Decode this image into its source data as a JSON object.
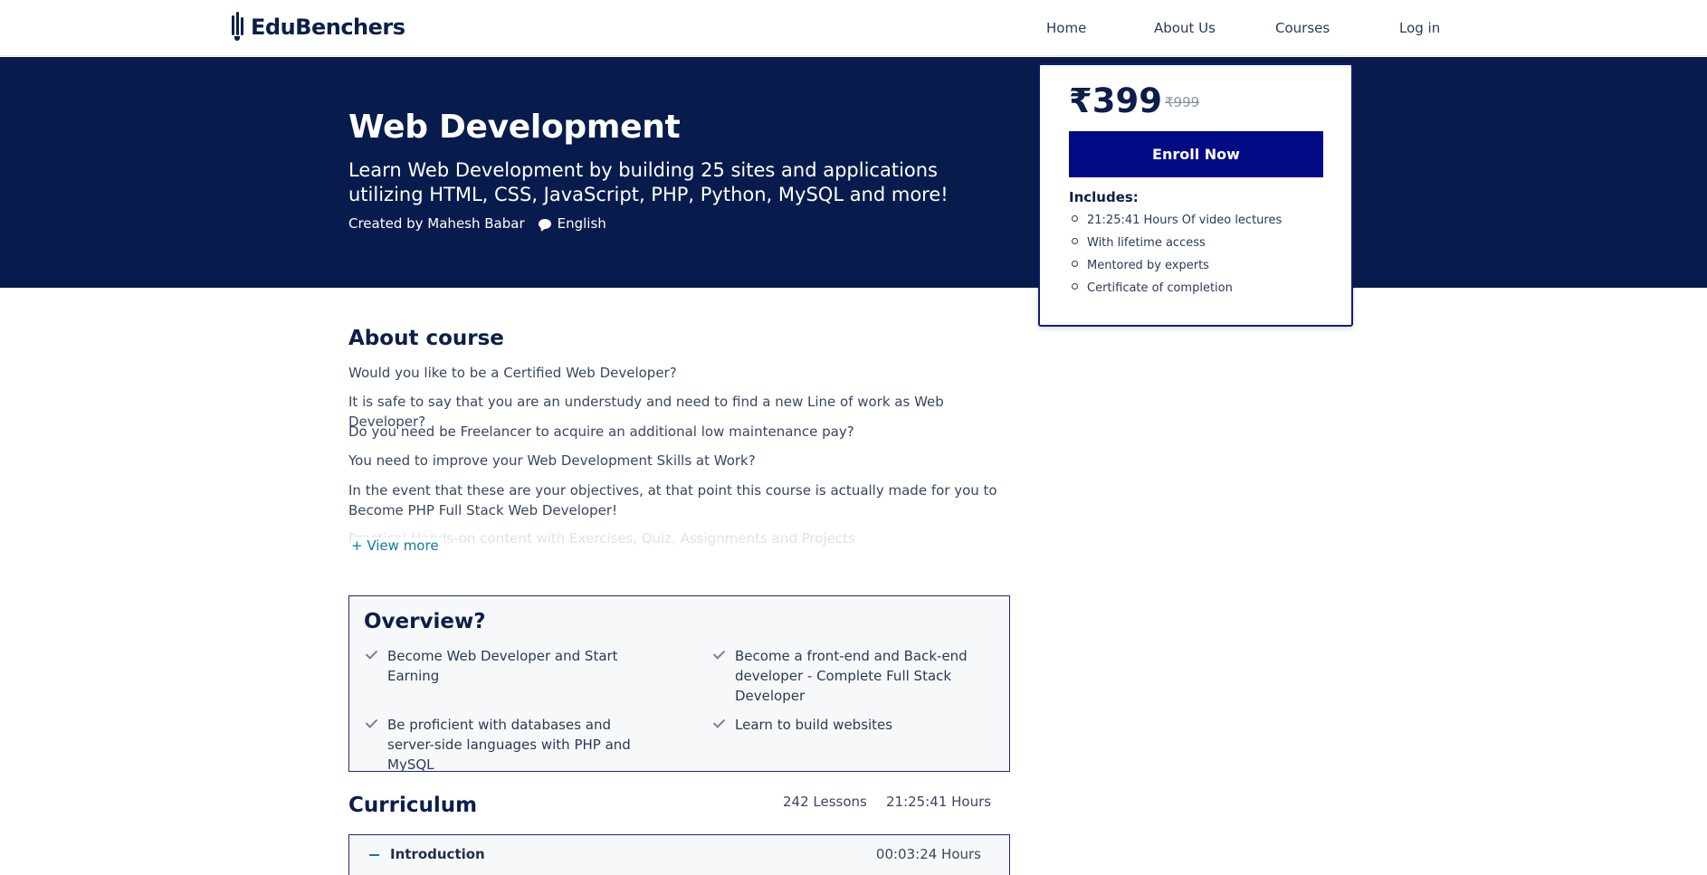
{
  "nav": {
    "brand": "EduBenchers",
    "links": [
      "Home",
      "About Us",
      "Courses",
      "Log in"
    ]
  },
  "hero": {
    "title": "Web Development",
    "subtitle": "Learn Web Development by building 25 sites and applications utilizing HTML, CSS, JavaScript, PHP, Python, MySQL and more!",
    "created_by": "Created by Mahesh Babar",
    "language": "English"
  },
  "pricing": {
    "price": "₹399",
    "original_price": "₹999",
    "enroll_label": "Enroll Now",
    "includes_label": "Includes:",
    "includes": [
      "21:25:41 Hours Of video lectures",
      "With lifetime access",
      "Mentored by experts",
      "Certificate of completion"
    ]
  },
  "about": {
    "heading": "About course",
    "paragraphs": [
      "Would you like to be a Certified Web Developer?",
      "It is safe to say that you are an understudy and need to find a new Line of work as Web Developer?",
      "Do you need be Freelancer to acquire an additional low maintenance pay?",
      "You need to improve your Web Development Skills at Work?",
      "In the event that these are your objectives, at that point this course is actually made for you to Become PHP Full Stack Web Developer!"
    ],
    "faded_text": "Practical Hands-on content with Exercises, Quiz, Assignments and Projects",
    "view_more": "+ View more"
  },
  "overview": {
    "heading": "Overview?",
    "items": [
      "Become Web Developer and Start Earning",
      "Become a front-end and Back-end developer - Complete Full Stack Developer",
      "Be proficient with databases and server-side languages with PHP and MySQL",
      "Learn to build websites"
    ]
  },
  "curriculum": {
    "heading": "Curriculum",
    "lessons": "242 Lessons",
    "hours": "21:25:41 Hours",
    "sections": [
      {
        "title": "Introduction",
        "duration": "00:03:24 Hours"
      }
    ]
  },
  "colors": {
    "hero_bg": "#071c4d",
    "enroll_bg": "#020b85",
    "link": "#0e7d9a"
  }
}
